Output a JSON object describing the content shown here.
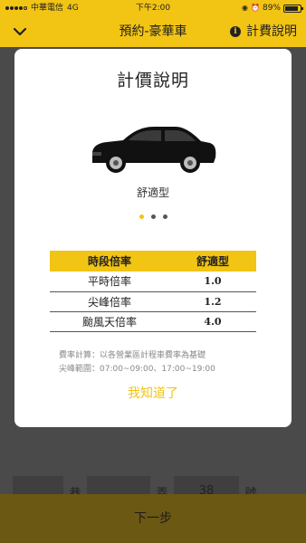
{
  "status_bar": {
    "carrier": "中華電信",
    "network": "4G",
    "time": "下午2:00",
    "battery": "89%",
    "battery_level": 0.89
  },
  "nav": {
    "title": "預約-豪華車",
    "right_label": "計費說明",
    "info_symbol": "i"
  },
  "modal": {
    "title": "計價說明",
    "car_type": "舒適型",
    "page_count": 3,
    "active_page": 1,
    "table": {
      "headers": [
        "時段倍率",
        "舒適型"
      ],
      "rows": [
        [
          "平時倍率",
          "1.0"
        ],
        [
          "尖峰倍率",
          "1.2"
        ],
        [
          "颱風天倍率",
          "4.0"
        ]
      ]
    },
    "note_fare": "費率計算：以各營業區計程車費率為基礎",
    "note_peak": "尖峰範圍：07:00~09:00、17:00~19:00",
    "confirm_label": "我知道了"
  },
  "background": {
    "lane_label": "巷",
    "alley_label": "弄",
    "number_value": "38",
    "number_label": "號",
    "next_label": "下一步"
  },
  "colors": {
    "accent": "#f2c414",
    "overlay": "#4a4a4a"
  },
  "icons": {
    "back": "chevron-down-icon",
    "info": "info-icon",
    "car": "sedan-car-icon"
  }
}
